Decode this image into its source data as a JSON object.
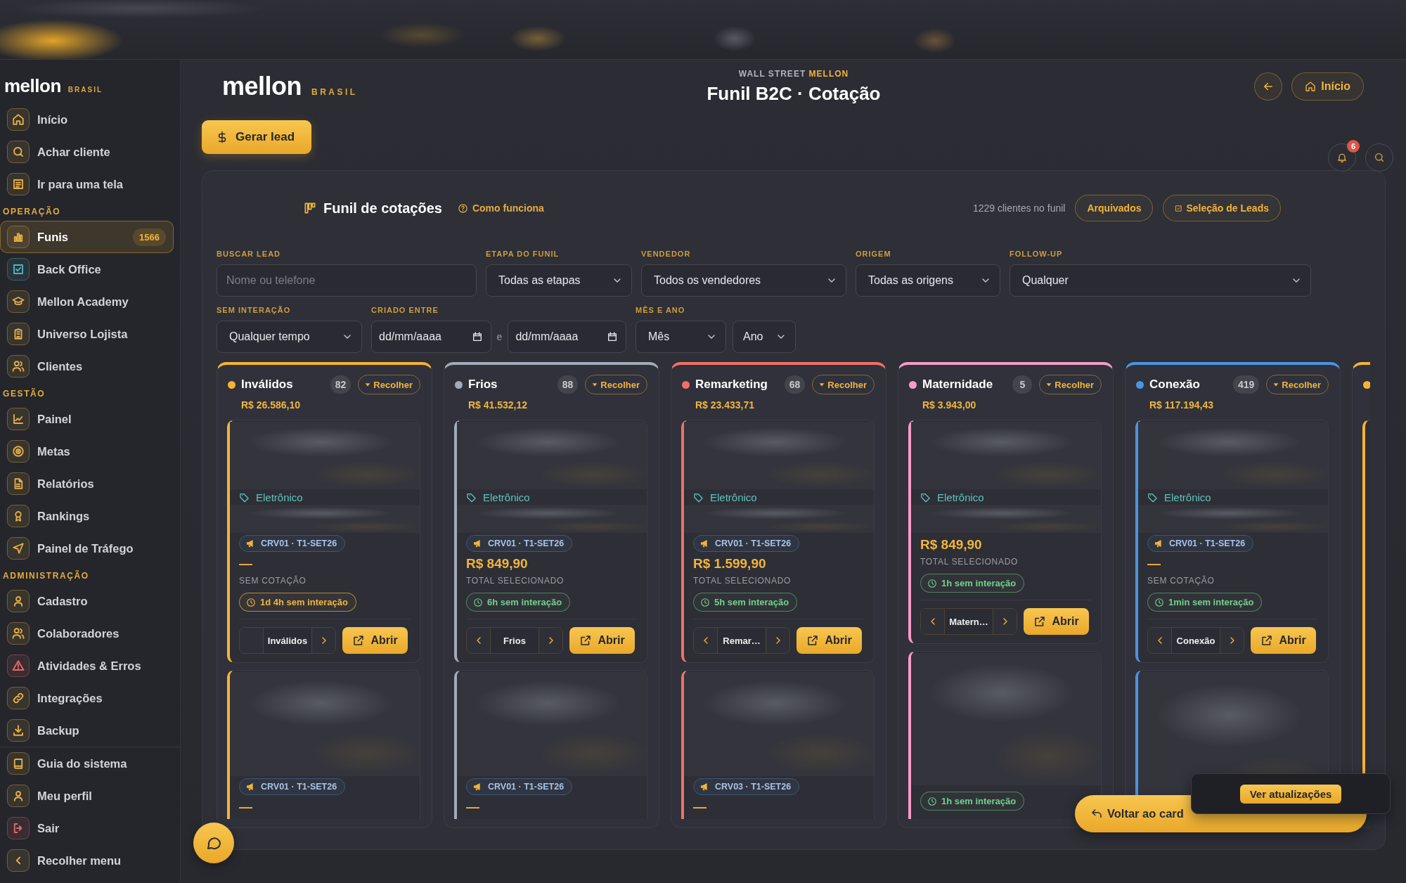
{
  "sidebar": {
    "logo": "mellon",
    "logo_suffix": "BRASIL",
    "sections": [
      {
        "items": [
          {
            "label": "Início",
            "color": "#e5ad45",
            "selected": false
          },
          {
            "label": "Achar cliente",
            "color": "#e5ad45",
            "selected": false
          },
          {
            "label": "Ir para uma tela",
            "color": "#e5ad45",
            "selected": false
          }
        ]
      },
      {
        "title": "OPERAÇÃO",
        "items": [
          {
            "label": "Funis",
            "color": "#e5ad45",
            "selected": true,
            "badge": "1566"
          },
          {
            "label": "Back Office",
            "color": "#4fb3bf",
            "selected": false
          },
          {
            "label": "Mellon Academy",
            "color": "#e5ad45",
            "selected": false
          },
          {
            "label": "Universo Lojista",
            "color": "#e5ad45",
            "selected": false
          },
          {
            "label": "Clientes",
            "color": "#e5ad45",
            "selected": false
          }
        ]
      },
      {
        "title": "GESTÃO",
        "items": [
          {
            "label": "Painel",
            "color": "#e5ad45",
            "selected": false
          },
          {
            "label": "Metas",
            "color": "#e5ad45",
            "selected": false
          },
          {
            "label": "Relatórios",
            "color": "#e5ad45",
            "selected": false
          },
          {
            "label": "Rankings",
            "color": "#e5ad45",
            "selected": false
          },
          {
            "label": "Painel de Tráfego",
            "color": "#e5ad45",
            "selected": false
          }
        ]
      },
      {
        "title": "ADMINISTRAÇÃO",
        "items": [
          {
            "label": "Cadastro",
            "color": "#e5ad45",
            "selected": false
          },
          {
            "label": "Colaboradores",
            "color": "#e5ad45",
            "selected": false
          },
          {
            "label": "Atividades & Erros",
            "color": "#e06a6a",
            "selected": false
          },
          {
            "label": "Integrações",
            "color": "#e5ad45",
            "selected": false
          },
          {
            "label": "Backup",
            "color": "#e5ad45",
            "selected": false
          }
        ]
      },
      {
        "items": [
          {
            "label": "Guia do sistema",
            "color": "#e5ad45",
            "selected": false
          },
          {
            "label": "Meu perfil",
            "color": "#e5ad45",
            "selected": false
          },
          {
            "label": "Sair",
            "color": "#e06a6a",
            "selected": false
          },
          {
            "label": "Recolher menu",
            "color": "#e5ad45",
            "selected": false
          }
        ]
      }
    ]
  },
  "header": {
    "logo": "mellon",
    "logo_suffix": "BRASIL",
    "kicker": "WALL STREET",
    "kicker_accent": "MELLON",
    "title": "Funil B2C · Cotação",
    "home_button": "Início"
  },
  "primary_button": "Gerar lead",
  "funnel_panel": {
    "title": "Funil de cotações",
    "help_link": "Como funciona",
    "client_count": "1229 clientes no funil",
    "archived_button": "Arquivados",
    "selection_button": "Seleção de Leads",
    "filter_rows": [
      [
        {
          "kind": "text",
          "label": "BUSCAR LEAD",
          "placeholder": "Nome ou telefone"
        },
        {
          "kind": "select",
          "label": "ETAPA DO FUNIL",
          "value": "Todas as etapas"
        },
        {
          "kind": "select",
          "label": "VENDEDOR",
          "value": "Todos os vendedores"
        },
        {
          "kind": "select",
          "label": "ORIGEM",
          "value": "Todas as origens"
        },
        {
          "kind": "select",
          "label": "FOLLOW-UP",
          "value": "Qualquer"
        }
      ],
      [
        {
          "kind": "select",
          "label": "SEM INTERAÇÃO",
          "value": "Qualquer tempo"
        },
        {
          "kind": "date_range",
          "label": "CRIADO ENTRE",
          "placeholders": [
            "dd/mm/aaaa",
            "dd/mm/aaaa"
          ],
          "separator": "e"
        },
        {
          "kind": "select_pair",
          "label": "MÊS E ANO",
          "values": [
            "Mês",
            "Ano"
          ]
        }
      ]
    ],
    "columns": [
      {
        "kind": "stage",
        "name": "Inválidos",
        "color": "#f5b335",
        "count": "82",
        "collapse_button": "Recolher",
        "total": "R$ 26.586,10",
        "cards": [
          {
            "kind": "full",
            "tag": "Eletrônico",
            "campaign": "CRV01 · T1-SET26",
            "amount": "—",
            "amount_label": "SEM COTAÇÃO",
            "idle": "1d 4h sem interação",
            "overdue": true,
            "stage": "Inválidos",
            "has_prev": false,
            "has_next": true,
            "open_button": "Abrir"
          },
          {
            "kind": "tail",
            "campaign": "CRV01 · T1-SET26",
            "amount": "—"
          }
        ]
      },
      {
        "kind": "stage",
        "name": "Frios",
        "color": "#a3abba",
        "count": "88",
        "collapse_button": "Recolher",
        "total": "R$ 41.532,12",
        "cards": [
          {
            "kind": "full",
            "tag": "Eletrônico",
            "campaign": "CRV01 · T1-SET26",
            "amount": "R$ 849,90",
            "amount_label": "TOTAL SELECIONADO",
            "idle": "6h sem interação",
            "overdue": false,
            "stage": "Frios",
            "has_prev": true,
            "has_next": true,
            "open_button": "Abrir"
          },
          {
            "kind": "tail",
            "campaign": "CRV01 · T1-SET26",
            "amount": "—"
          }
        ]
      },
      {
        "kind": "stage",
        "name": "Remarketing",
        "color": "#f07068",
        "count": "68",
        "collapse_button": "Recolher",
        "total": "R$ 23.433,71",
        "cards": [
          {
            "kind": "full",
            "tag": "Eletrônico",
            "campaign": "CRV01 · T1-SET26",
            "amount": "R$ 1.599,90",
            "amount_label": "TOTAL SELECIONADO",
            "idle": "5h sem interação",
            "overdue": false,
            "stage": "Remar…",
            "has_prev": true,
            "has_next": true,
            "open_button": "Abrir"
          },
          {
            "kind": "tail",
            "campaign": "CRV03 · T1-SET26",
            "amount": "—"
          }
        ]
      },
      {
        "kind": "stage",
        "name": "Maternidade",
        "color": "#f59cc8",
        "count": "5",
        "collapse_button": "Recolher",
        "total": "R$ 3.943,00",
        "cards": [
          {
            "kind": "full",
            "tag": "Eletrônico",
            "amount": "R$ 849,90",
            "amount_label": "TOTAL SELECIONADO",
            "idle": "1h sem interação",
            "overdue": false,
            "stage": "Matern…",
            "has_prev": true,
            "has_next": true,
            "open_button": "Abrir"
          },
          {
            "kind": "tail",
            "idle": "1h sem interação",
            "overdue": false
          }
        ]
      },
      {
        "kind": "stage",
        "name": "Conexão",
        "color": "#4b94e0",
        "count": "419",
        "collapse_button": "Recolher",
        "total": "R$ 117.194,43",
        "cards": [
          {
            "kind": "full",
            "tag": "Eletrônico",
            "campaign": "CRV01 · T1-SET26",
            "amount": "—",
            "amount_label": "SEM COTAÇÃO",
            "idle": "1min sem interação",
            "overdue": false,
            "stage": "Conexão",
            "has_prev": true,
            "has_next": true,
            "open_button": "Abrir"
          },
          {
            "kind": "tail"
          }
        ]
      },
      {
        "kind": "peek",
        "color": "#f5b335"
      }
    ]
  },
  "floating": {
    "notification_count": "6",
    "return_button": "Voltar ao card",
    "updates_button": "Ver atualizações"
  }
}
